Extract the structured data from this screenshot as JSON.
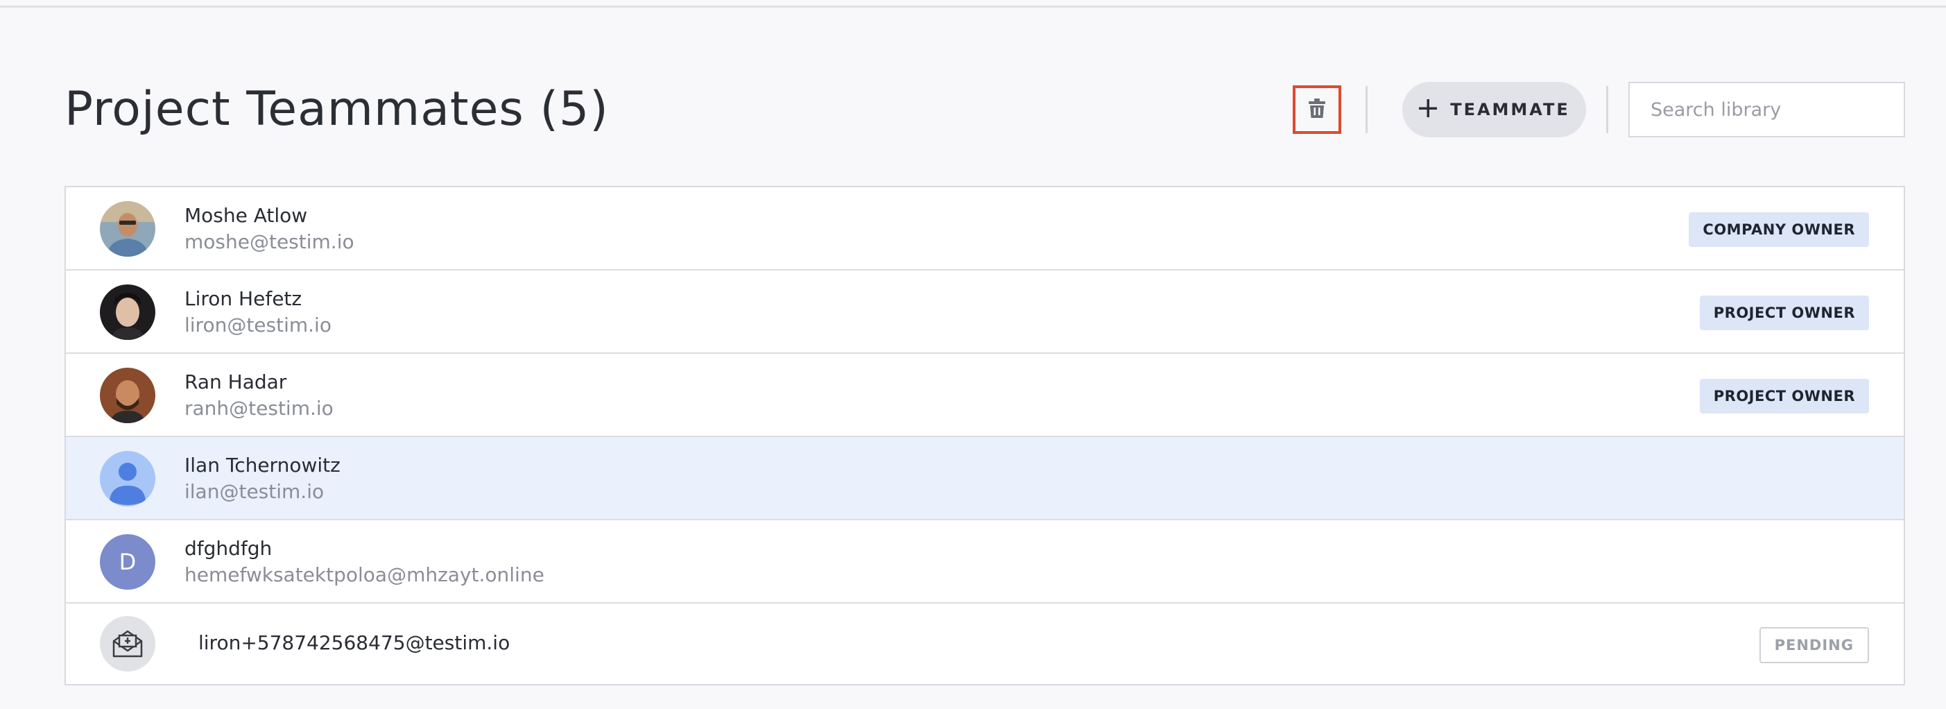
{
  "header": {
    "title": "Project Teammates (5)",
    "add_button_label": "TEAMMATE",
    "search_placeholder": "Search library"
  },
  "icons": {
    "delete": "trash-icon",
    "add": "plus-icon",
    "invite": "envelope-icon"
  },
  "colors": {
    "delete_highlight": "#e0492f",
    "selected_row": "#eaf0fc",
    "badge_bg": "#dde6f7",
    "letter_avatar": "#7b8bcc"
  },
  "teammates": [
    {
      "name": "Moshe Atlow",
      "email": "moshe@testim.io",
      "role": "COMPANY OWNER"
    },
    {
      "name": "Liron Hefetz",
      "email": "liron@testim.io",
      "role": "PROJECT OWNER"
    },
    {
      "name": "Ran Hadar",
      "email": "ranh@testim.io",
      "role": "PROJECT OWNER"
    },
    {
      "name": "Ilan Tchernowitz",
      "email": "ilan@testim.io",
      "role": ""
    },
    {
      "name": "dfghdfgh",
      "email": "hemefwksatektpoloa@mhzayt.online",
      "role": "",
      "initial": "D"
    }
  ],
  "pending_invite": {
    "email": "liron+578742568475@testim.io",
    "status": "PENDING"
  }
}
